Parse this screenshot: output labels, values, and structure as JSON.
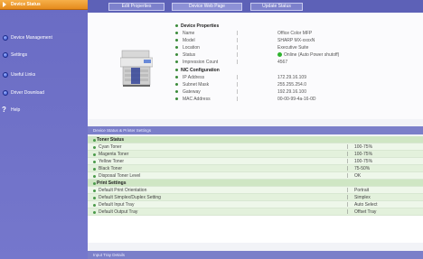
{
  "sidebar": {
    "active_label": "Device Status",
    "items": [
      {
        "label": "Device Management"
      },
      {
        "label": "Settings"
      },
      {
        "label": "Useful Links"
      },
      {
        "label": "Driver Download"
      },
      {
        "label": "Help"
      }
    ]
  },
  "toolbar": {
    "buttons": [
      "Edit Properties",
      "Device Web Page",
      "Update Status"
    ]
  },
  "device": {
    "heading": "Device Properties",
    "rows": [
      {
        "k": "Name",
        "v": "Office Color MFP"
      },
      {
        "k": "Model",
        "v": "SHARP MX-xxxxN"
      },
      {
        "k": "Location",
        "v": "Executive Suite"
      },
      {
        "k": "Status",
        "v": "Online (Auto Power shutoff)"
      },
      {
        "k": "Impression Count",
        "v": "4567"
      }
    ]
  },
  "nic": {
    "heading": "NIC Configuration",
    "rows": [
      {
        "k": "IP Address",
        "v": "172.29.16.109"
      },
      {
        "k": "Subnet Mask",
        "v": "255.255.254.0"
      },
      {
        "k": "Gateway",
        "v": "192.29.16.100"
      },
      {
        "k": "MAC Address",
        "v": "00-00-99-4a-16-0D"
      }
    ]
  },
  "status_section": {
    "title": "Device Status & Printer Settings",
    "toner_heading": "Toner Status",
    "toner": [
      {
        "k": "Cyan Toner",
        "v": "100-75%"
      },
      {
        "k": "Magenta Toner",
        "v": "100-75%"
      },
      {
        "k": "Yellow Toner",
        "v": "100-75%"
      },
      {
        "k": "Black Toner",
        "v": "75-50%"
      },
      {
        "k": "Disposal Toner Level",
        "v": "OK"
      }
    ],
    "print_heading": "Print Settings",
    "print": [
      {
        "k": "Default Print Orientation",
        "v": "Portrait"
      },
      {
        "k": "Default Simplex/Duplex Setting",
        "v": "Simplex"
      },
      {
        "k": "Default Input Tray",
        "v": "Auto Select"
      },
      {
        "k": "Default Output Tray",
        "v": "Offset Tray"
      }
    ]
  },
  "bottom_section": {
    "title": "Input Tray Details"
  }
}
